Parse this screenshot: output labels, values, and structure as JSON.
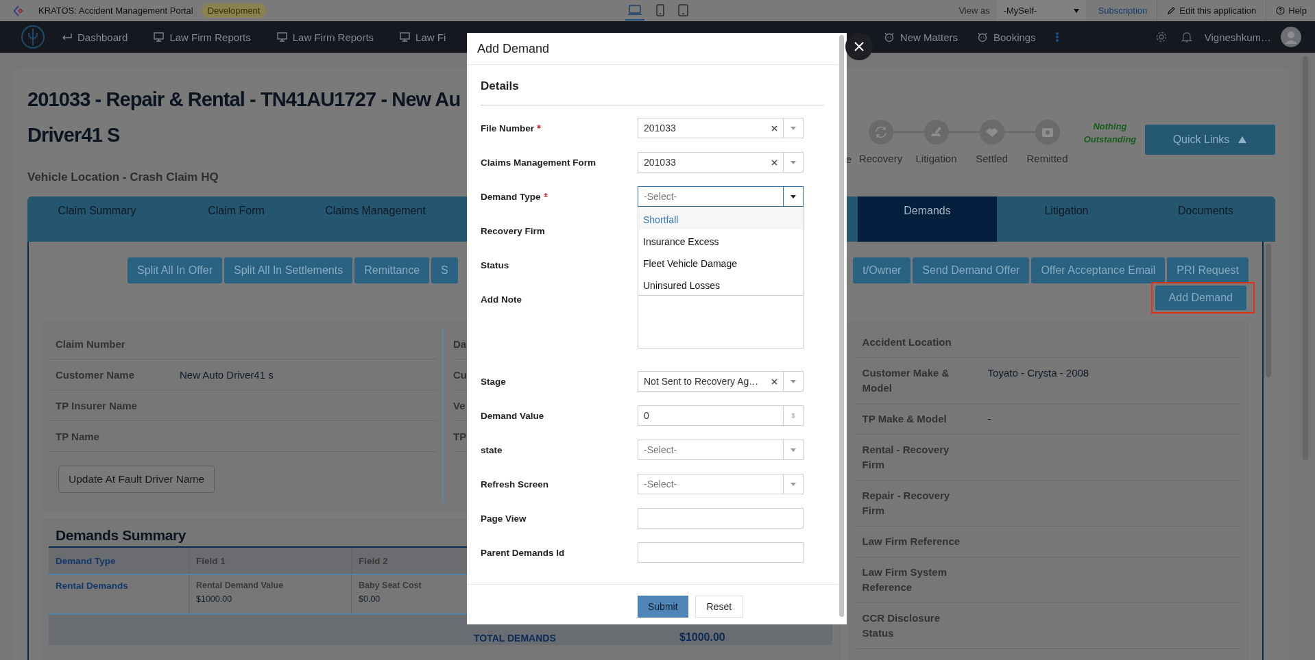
{
  "top_bar": {
    "app_title": "KRATOS: Accident Management Portal",
    "env_badge": "Development",
    "device_views": [
      {
        "kind": "laptop",
        "selected": true
      },
      {
        "kind": "phone",
        "selected": false
      },
      {
        "kind": "tablet",
        "selected": false
      }
    ],
    "view_as_label": "View as",
    "view_as_value": "-MySelf-",
    "subscription": "Subscription",
    "edit_link": "Edit this application",
    "help": "Help"
  },
  "nav": {
    "left_items": [
      {
        "kind": "dashboard",
        "label": "Dashboard"
      },
      {
        "kind": "report",
        "label": "Law Firm Reports"
      },
      {
        "kind": "report",
        "label": "Law Firm Reports"
      },
      {
        "kind": "report",
        "label": "Law Fi"
      }
    ],
    "right_items": [
      {
        "label": "New Matters"
      },
      {
        "label": "Bookings"
      }
    ],
    "user": "Vigneshkum…"
  },
  "claim": {
    "title_lines": [
      "201033 - Repair & Rental - TN41AU1727 - New Au",
      "Driver41 S"
    ],
    "vehicle_location": "Vehicle Location - Crash Claim HQ",
    "partial_step_label": "e",
    "steps": [
      {
        "kind": "recovery",
        "label": "Recovery"
      },
      {
        "kind": "litigation",
        "label": "Litigation"
      },
      {
        "kind": "settled",
        "label": "Settled"
      },
      {
        "kind": "remitted",
        "label": "Remitted"
      }
    ],
    "outstanding": "Nothing Outstanding",
    "quick_links": "Quick Links"
  },
  "tabs": {
    "left": [
      {
        "label": "Claim Summary",
        "selected": false
      },
      {
        "label": "Claim Form",
        "selected": false
      },
      {
        "label": "Claims Management",
        "selected": false
      }
    ],
    "right": [
      {
        "label": "Demands",
        "selected": true
      },
      {
        "label": "Litigation",
        "selected": false
      },
      {
        "label": "Documents",
        "selected": false
      }
    ]
  },
  "actions": {
    "left": [
      "Split All In Offer",
      "Split All In Settlements",
      "Remittance",
      "S"
    ],
    "right": [
      "t/Owner",
      "Send Demand Offer",
      "Offer Acceptance Email",
      "PRI Request"
    ],
    "add_demand": {
      "label": "Add Demand",
      "highlighted": true
    }
  },
  "claim_info": {
    "rows": [
      {
        "label": "Claim Number"
      },
      {
        "label": "Customer Name",
        "value": "New Auto Driver41 s"
      },
      {
        "label": "TP Insurer Name"
      },
      {
        "label": "TP Name"
      }
    ],
    "update_button": "Update At Fault Driver Name",
    "second_column_labels": [
      "Da",
      "Cu",
      "Ve",
      "TP"
    ]
  },
  "vehicle_info": {
    "rows": [
      {
        "label": "Accident Location"
      },
      {
        "label": "Customer Make & Model",
        "value": "Toyato - Crysta - 2008"
      },
      {
        "label": "TP Make & Model",
        "value": "-"
      },
      {
        "label": "Rental - Recovery Firm"
      },
      {
        "label": "Repair - Recovery Firm"
      },
      {
        "label": "Law Firm Reference"
      },
      {
        "label": "Law Firm System Reference"
      },
      {
        "label": "CCR Disclosure Status"
      }
    ]
  },
  "demands_summary": {
    "title": "Demands Summary",
    "columns": [
      "Demand Type",
      "Field 1",
      "Field 2"
    ],
    "rows": [
      {
        "demand_type": "Rental Demands",
        "fields": [
          {
            "label": "Rental Demand Value",
            "value": "$1000.00"
          },
          {
            "label": "Baby Seat Cost",
            "value": "$0.00"
          }
        ]
      }
    ],
    "total_label": "TOTAL DEMANDS",
    "total_value": "$1000.00"
  },
  "modal": {
    "title": "Add Demand",
    "section": "Details",
    "fields": [
      {
        "kind": "select",
        "label": "File Number",
        "required": true,
        "value": "201033",
        "clearable": true,
        "focused": false
      },
      {
        "kind": "select",
        "label": "Claims Management Form",
        "required": false,
        "value": "201033",
        "clearable": true,
        "focused": false
      },
      {
        "kind": "select",
        "label": "Demand Type",
        "required": true,
        "placeholder": "-Select-",
        "clearable": false,
        "focused": true,
        "options": [
          {
            "label": "Shortfall",
            "selected": true
          },
          {
            "label": "Insurance Excess",
            "selected": false
          },
          {
            "label": "Fleet Vehicle Damage",
            "selected": false
          },
          {
            "label": "Uninsured Losses",
            "selected": false
          }
        ]
      },
      {
        "kind": "covered",
        "label": "Recovery Firm",
        "required": false
      },
      {
        "kind": "covered",
        "label": "Status",
        "required": false
      },
      {
        "kind": "textarea",
        "label": "Add Note",
        "required": false
      },
      {
        "kind": "select",
        "label": "Stage",
        "required": false,
        "value": "Not Sent to Recovery Ag…",
        "clearable": true,
        "focused": false
      },
      {
        "kind": "money",
        "label": "Demand Value",
        "required": false,
        "value": "0",
        "addon": "$"
      },
      {
        "kind": "select",
        "label": "state",
        "required": false,
        "placeholder": "-Select-",
        "clearable": false,
        "focused": false
      },
      {
        "kind": "select",
        "label": "Refresh Screen",
        "required": false,
        "placeholder": "-Select-",
        "clearable": false,
        "focused": false
      },
      {
        "kind": "text",
        "label": "Page View",
        "required": false
      },
      {
        "kind": "text",
        "label": "Parent Demands Id",
        "required": false
      }
    ],
    "submit": "Submit",
    "reset": "Reset"
  }
}
